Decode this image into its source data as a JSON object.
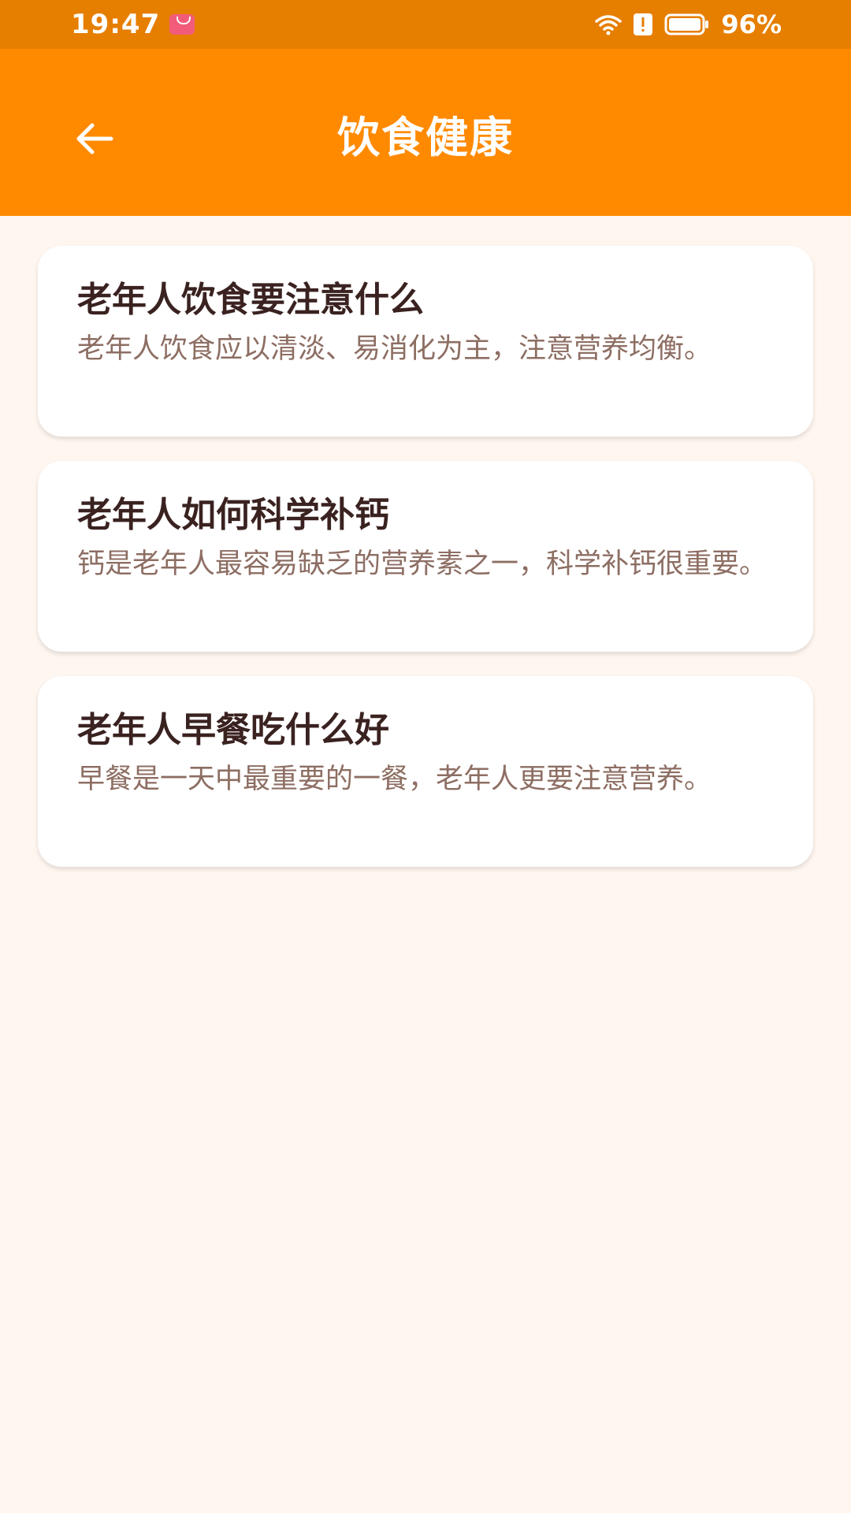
{
  "status_bar": {
    "time": "19:47",
    "battery_percent": "96%",
    "icons": [
      "app-store-icon",
      "wifi-icon",
      "alert-icon",
      "battery-icon"
    ]
  },
  "app_bar": {
    "title": "饮食健康",
    "back_icon": "arrow-left-icon",
    "color": "#FF8A00"
  },
  "articles": [
    {
      "title": "老年人饮食要注意什么",
      "summary": "老年人饮食应以清淡、易消化为主，注意营养均衡。"
    },
    {
      "title": "老年人如何科学补钙",
      "summary": "钙是老年人最容易缺乏的营养素之一，科学补钙很重要。"
    },
    {
      "title": "老年人早餐吃什么好",
      "summary": "早餐是一天中最重要的一餐，老年人更要注意营养。"
    }
  ],
  "colors": {
    "status_bar": "#E67E00",
    "background": "#FFF6F0",
    "title_text": "#3A2220",
    "summary_text": "#8D6E63"
  }
}
